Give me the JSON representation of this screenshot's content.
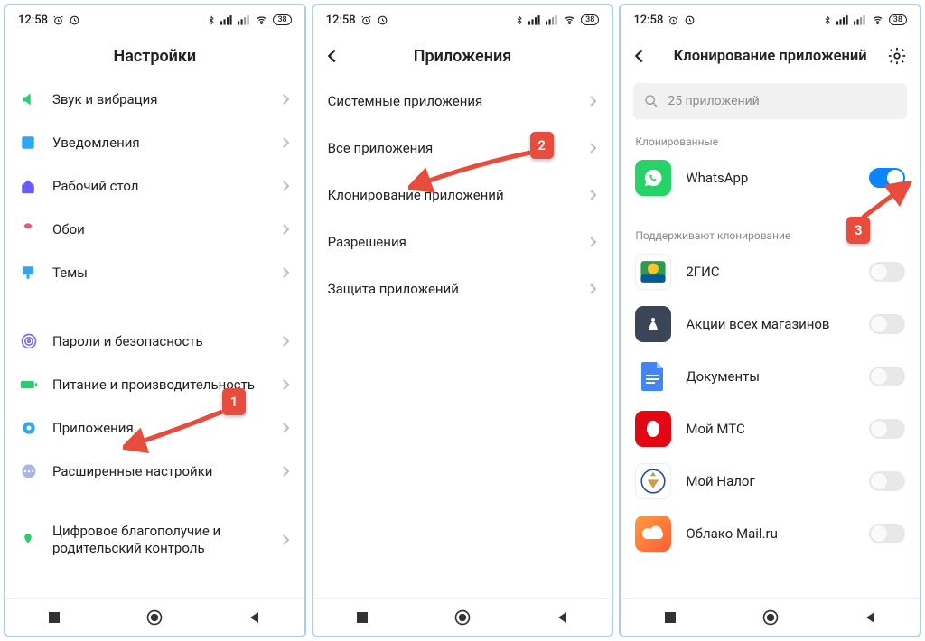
{
  "status": {
    "time": "12:58",
    "battery": "38"
  },
  "badges": {
    "b1": "1",
    "b2": "2",
    "b3": "3"
  },
  "screen1": {
    "title": "Настройки",
    "items": [
      {
        "label": "Звук и вибрация"
      },
      {
        "label": "Уведомления"
      },
      {
        "label": "Рабочий стол"
      },
      {
        "label": "Обои"
      },
      {
        "label": "Темы"
      }
    ],
    "items2": [
      {
        "label": "Пароли и безопасность"
      },
      {
        "label": "Питание и производительность"
      },
      {
        "label": "Приложения"
      },
      {
        "label": "Расширенные настройки"
      }
    ],
    "items3": [
      {
        "label": "Цифровое благополучие и родительский контроль"
      }
    ]
  },
  "screen2": {
    "title": "Приложения",
    "items": [
      {
        "label": "Системные приложения"
      },
      {
        "label": "Все приложения"
      },
      {
        "label": "Клонирование приложений"
      },
      {
        "label": "Разрешения"
      },
      {
        "label": "Защита приложений"
      }
    ]
  },
  "screen3": {
    "title": "Клонирование приложений",
    "search_placeholder": "25 приложений",
    "section_cloned": "Клонированные",
    "section_support": "Поддерживают клонирование",
    "cloned": [
      {
        "label": "WhatsApp"
      }
    ],
    "apps": [
      {
        "label": "2ГИС"
      },
      {
        "label": "Акции всех магазинов"
      },
      {
        "label": "Документы"
      },
      {
        "label": "Мой МТС"
      },
      {
        "label": "Мой Налог"
      },
      {
        "label": "Облако Mail.ru"
      }
    ]
  }
}
